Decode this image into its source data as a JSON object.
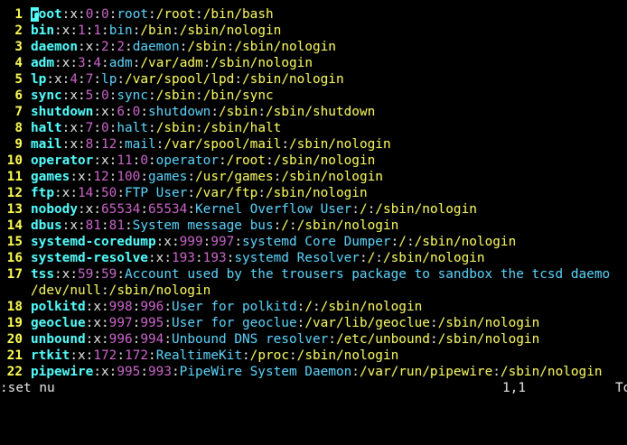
{
  "lines": [
    {
      "nr": "1",
      "user": "root",
      "uid": "0",
      "gid": "0",
      "gecos": "root",
      "home": "/root",
      "shell": "/bin/bash"
    },
    {
      "nr": "2",
      "user": "bin",
      "uid": "1",
      "gid": "1",
      "gecos": "bin",
      "home": "/bin",
      "shell": "/sbin/nologin"
    },
    {
      "nr": "3",
      "user": "daemon",
      "uid": "2",
      "gid": "2",
      "gecos": "daemon",
      "home": "/sbin",
      "shell": "/sbin/nologin"
    },
    {
      "nr": "4",
      "user": "adm",
      "uid": "3",
      "gid": "4",
      "gecos": "adm",
      "home": "/var/adm",
      "shell": "/sbin/nologin"
    },
    {
      "nr": "5",
      "user": "lp",
      "uid": "4",
      "gid": "7",
      "gecos": "lp",
      "home": "/var/spool/lpd",
      "shell": "/sbin/nologin"
    },
    {
      "nr": "6",
      "user": "sync",
      "uid": "5",
      "gid": "0",
      "gecos": "sync",
      "home": "/sbin",
      "shell": "/bin/sync"
    },
    {
      "nr": "7",
      "user": "shutdown",
      "uid": "6",
      "gid": "0",
      "gecos": "shutdown",
      "home": "/sbin",
      "shell": "/sbin/shutdown"
    },
    {
      "nr": "8",
      "user": "halt",
      "uid": "7",
      "gid": "0",
      "gecos": "halt",
      "home": "/sbin",
      "shell": "/sbin/halt"
    },
    {
      "nr": "9",
      "user": "mail",
      "uid": "8",
      "gid": "12",
      "gecos": "mail",
      "home": "/var/spool/mail",
      "shell": "/sbin/nologin"
    },
    {
      "nr": "10",
      "user": "operator",
      "uid": "11",
      "gid": "0",
      "gecos": "operator",
      "home": "/root",
      "shell": "/sbin/nologin"
    },
    {
      "nr": "11",
      "user": "games",
      "uid": "12",
      "gid": "100",
      "gecos": "games",
      "home": "/usr/games",
      "shell": "/sbin/nologin"
    },
    {
      "nr": "12",
      "user": "ftp",
      "uid": "14",
      "gid": "50",
      "gecos": "FTP User",
      "home": "/var/ftp",
      "shell": "/sbin/nologin"
    },
    {
      "nr": "13",
      "user": "nobody",
      "uid": "65534",
      "gid": "65534",
      "gecos": "Kernel Overflow User",
      "home": "/",
      "shell": "/sbin/nologin"
    },
    {
      "nr": "14",
      "user": "dbus",
      "uid": "81",
      "gid": "81",
      "gecos": "System message bus",
      "home": "/",
      "shell": "/sbin/nologin"
    },
    {
      "nr": "15",
      "user": "systemd-coredump",
      "uid": "999",
      "gid": "997",
      "gecos": "systemd Core Dumper",
      "home": "/",
      "shell": "/sbin/nologin"
    },
    {
      "nr": "16",
      "user": "systemd-resolve",
      "uid": "193",
      "gid": "193",
      "gecos": "systemd Resolver",
      "home": "/",
      "shell": "/sbin/nologin"
    },
    {
      "nr": "17",
      "user": "tss",
      "uid": "59",
      "gid": "59",
      "gecos": "Account used by the trousers package to sandbox the tcsd daemo",
      "home": "/dev/null",
      "shell": "/sbin/nologin",
      "wrapped": true
    },
    {
      "nr": "18",
      "user": "polkitd",
      "uid": "998",
      "gid": "996",
      "gecos": "User for polkitd",
      "home": "/",
      "shell": "/sbin/nologin"
    },
    {
      "nr": "19",
      "user": "geoclue",
      "uid": "997",
      "gid": "995",
      "gecos": "User for geoclue",
      "home": "/var/lib/geoclue",
      "shell": "/sbin/nologin"
    },
    {
      "nr": "20",
      "user": "unbound",
      "uid": "996",
      "gid": "994",
      "gecos": "Unbound DNS resolver",
      "home": "/etc/unbound",
      "shell": "/sbin/nologin"
    },
    {
      "nr": "21",
      "user": "rtkit",
      "uid": "172",
      "gid": "172",
      "gecos": "RealtimeKit",
      "home": "/proc",
      "shell": "/sbin/nologin"
    },
    {
      "nr": "22",
      "user": "pipewire",
      "uid": "995",
      "gid": "993",
      "gecos": "PipeWire System Daemon",
      "home": "/var/run/pipewire",
      "shell": "/sbin/nologin"
    }
  ],
  "status": {
    "command": ":set nu",
    "ruler": "1,1",
    "position": "To"
  }
}
